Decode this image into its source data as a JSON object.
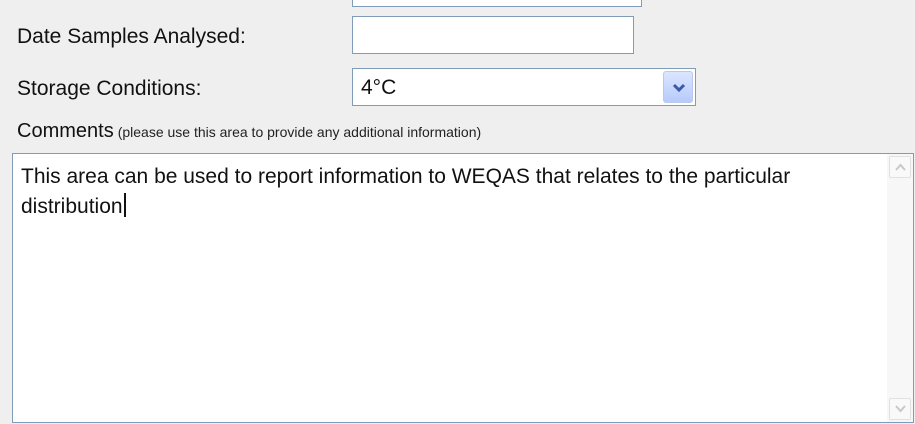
{
  "form": {
    "date_samples_label": "Date Samples Analysed:",
    "date_samples_value": "",
    "storage_label": "Storage Conditions:",
    "storage_selected": "4°C",
    "comments_label": "Comments",
    "comments_hint": "(please use this area to provide any additional information)",
    "comments_text": "This area can be used to report information to WEQAS that relates to the particular distribution"
  },
  "icons": {
    "dropdown": "chevron-down-icon",
    "scroll_up": "scroll-up-icon",
    "scroll_down": "scroll-down-icon"
  },
  "colors": {
    "background": "#efefef",
    "input_border": "#7f9db9",
    "dropdown_button": "#c5d6fc"
  }
}
